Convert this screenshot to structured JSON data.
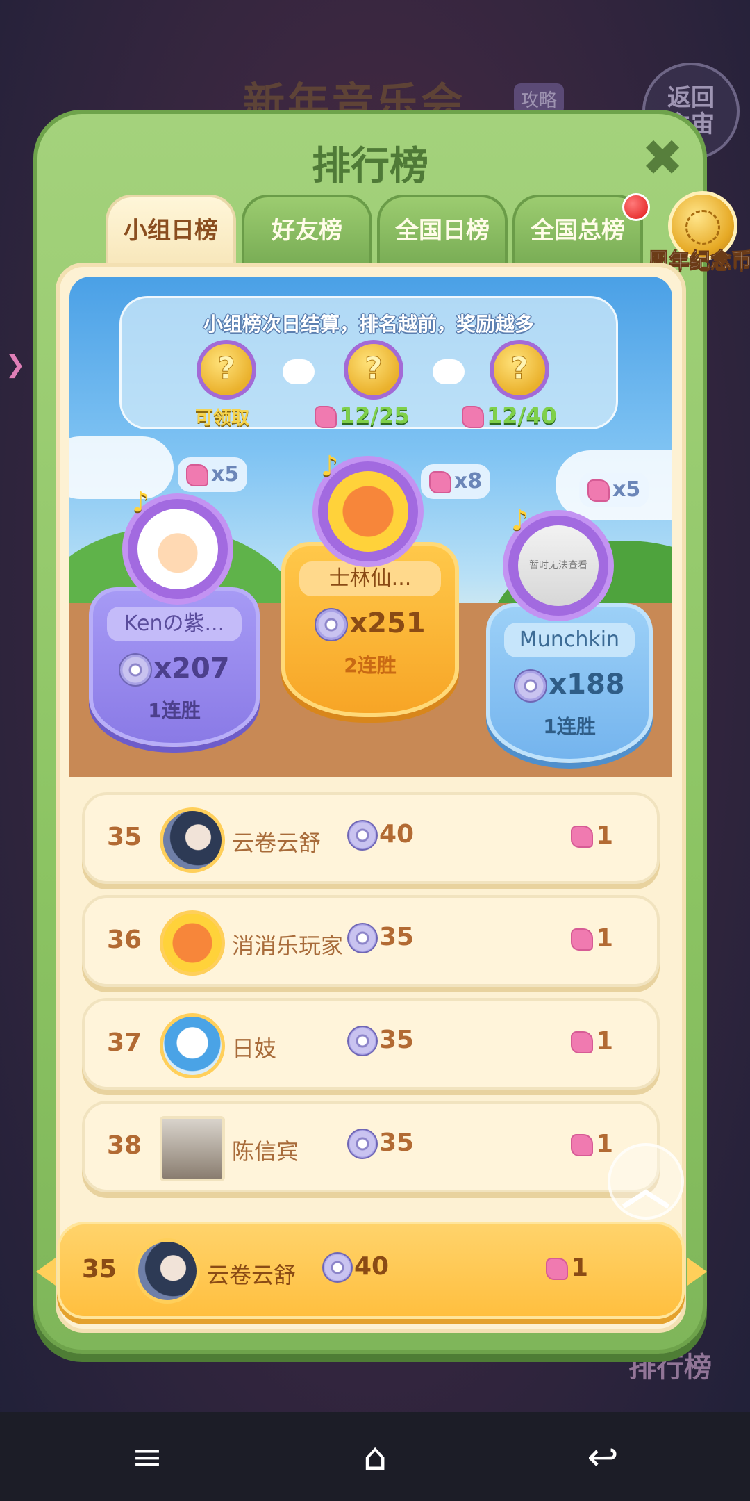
{
  "background": {
    "title": "新年音乐会",
    "badge": "攻略",
    "return_label": "返回\n主宙",
    "rank_label": "排行榜"
  },
  "panel": {
    "title": "排行榜",
    "close_icon": "close-icon"
  },
  "tabs": [
    {
      "label": "小组日榜",
      "active": true
    },
    {
      "label": "好友榜",
      "active": false
    },
    {
      "label": "全国日榜",
      "active": false
    },
    {
      "label": "全国总榜",
      "active": false
    }
  ],
  "anniversary_coin": {
    "label": "周年纪念币"
  },
  "rewards": {
    "title": "小组榜次日结算，排名越前，奖励越多",
    "claim_label": "可领取",
    "progress_1": "12/25",
    "progress_2": "12/40"
  },
  "podium": {
    "first": {
      "name": "士林仙...",
      "score": "x251",
      "streak": "2连胜",
      "bonus": "x8"
    },
    "second": {
      "name": "Kenの紫...",
      "score": "x207",
      "streak": "1连胜",
      "bonus": "x5"
    },
    "third": {
      "name": "Munchkin",
      "score": "x188",
      "streak": "1连胜",
      "bonus": "x5",
      "avatar_text": "暂时无法查看"
    }
  },
  "rows": [
    {
      "rank": "35",
      "name": "云卷云舒",
      "score": "40",
      "prize": "1"
    },
    {
      "rank": "36",
      "name": "消消乐玩家",
      "score": "35",
      "prize": "1"
    },
    {
      "rank": "37",
      "name": "日妓",
      "score": "35",
      "prize": "1"
    },
    {
      "rank": "38",
      "name": "陈信宾",
      "score": "35",
      "prize": "1"
    }
  ],
  "my_row": {
    "rank": "35",
    "name": "云卷云舒",
    "score": "40",
    "prize": "1"
  },
  "navbar": {
    "menu_icon": "menu-icon",
    "home_icon": "home-icon",
    "back_icon": "back-icon"
  }
}
